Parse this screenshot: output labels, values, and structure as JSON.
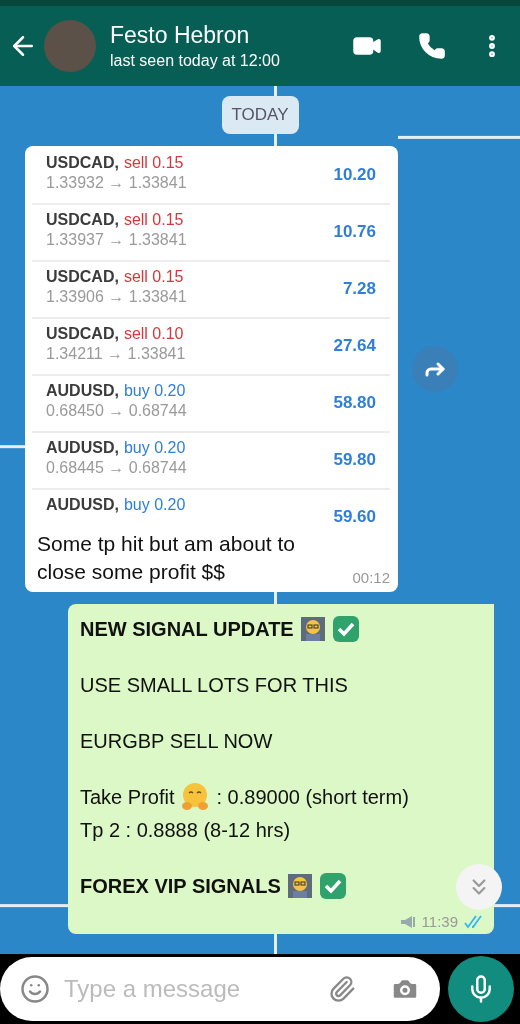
{
  "header": {
    "title": "Festo Hebron",
    "subtitle": "last seen today at 12:00"
  },
  "date_badge": "TODAY",
  "messages": [
    {
      "kind": "incoming",
      "trades": [
        {
          "pair": "USDCAD,",
          "kind": "sell",
          "order": "sell 0.15",
          "prices": "1.33932 → 1.33841",
          "profit": "10.20"
        },
        {
          "pair": "USDCAD,",
          "kind": "sell",
          "order": "sell 0.15",
          "prices": "1.33937 → 1.33841",
          "profit": "10.76"
        },
        {
          "pair": "USDCAD,",
          "kind": "sell",
          "order": "sell 0.15",
          "prices": "1.33906 → 1.33841",
          "profit": "7.28"
        },
        {
          "pair": "USDCAD,",
          "kind": "sell",
          "order": "sell 0.10",
          "prices": "1.34211 → 1.33841",
          "profit": "27.64"
        },
        {
          "pair": "AUDUSD,",
          "kind": "buy",
          "order": "buy 0.20",
          "prices": "0.68450 → 0.68744",
          "profit": "58.80"
        },
        {
          "pair": "AUDUSD,",
          "kind": "buy",
          "order": "buy 0.20",
          "prices": "0.68445 → 0.68744",
          "profit": "59.80"
        },
        {
          "pair": "AUDUSD,",
          "kind": "buy",
          "order": "buy 0.20",
          "profit": "59.60"
        }
      ],
      "caption": "Some tp hit but am about  to close some profit $$",
      "time": "00:12"
    },
    {
      "kind": "outgoing",
      "paragraphs": [
        [
          {
            "kind": "heading",
            "text": "NEW SIGNAL UPDATE"
          }
        ],
        [
          {
            "kind": "plain",
            "text": "USE SMALL LOTS FOR THIS"
          }
        ],
        [
          {
            "kind": "plain",
            "text": "EURGBP SELL NOW"
          }
        ],
        [
          {
            "kind": "hug",
            "text": "Take Profit",
            "after": ": 0.89000 (short term)"
          },
          {
            "kind": "plain",
            "text": "Tp 2 : 0.8888 (8-12 hrs)"
          }
        ],
        [
          {
            "kind": "heading",
            "text": "FOREX VIP SIGNALS"
          }
        ]
      ],
      "time": "11:39",
      "read": true
    }
  ],
  "composer": {
    "placeholder": "Type a message"
  }
}
